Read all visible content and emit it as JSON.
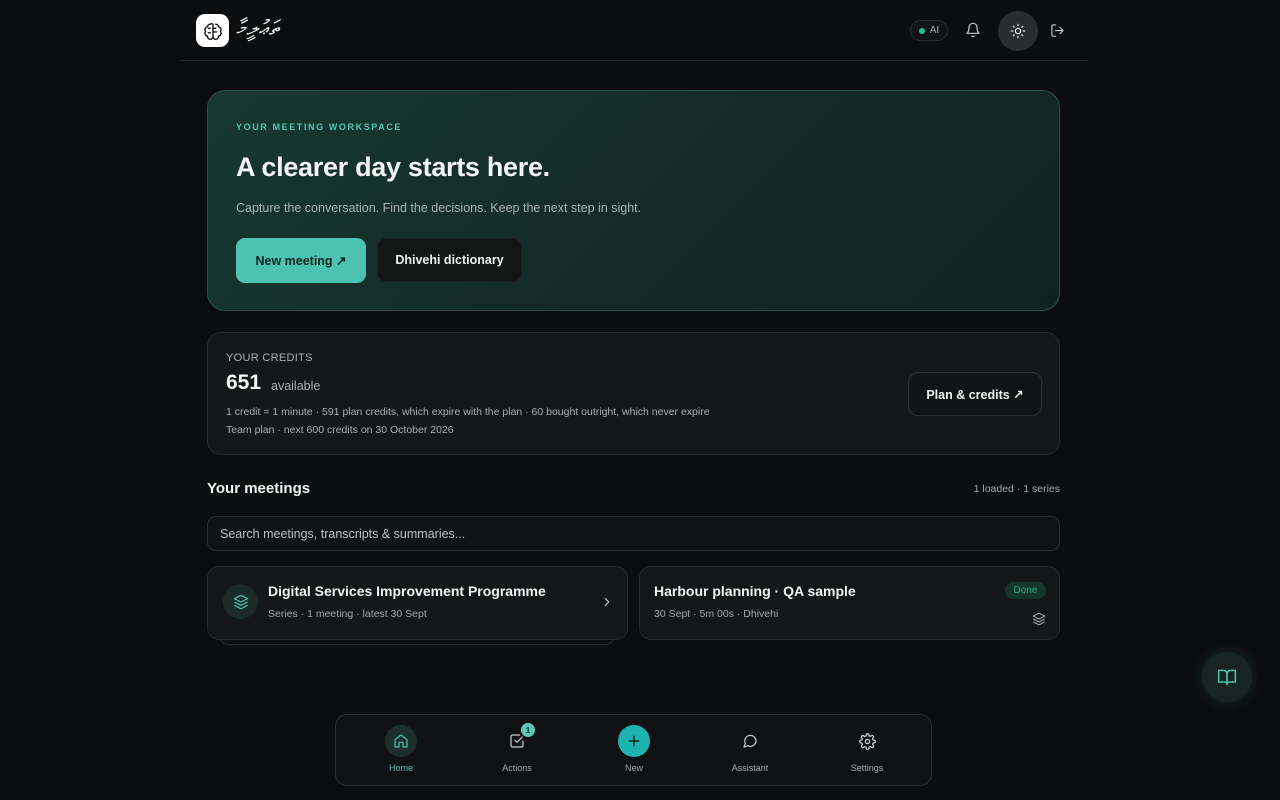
{
  "header": {
    "brand": "ތަޢުލީމާ",
    "ai_label": "AI",
    "colors": {
      "ai_status": "#22c08a"
    }
  },
  "hero": {
    "kicker": "YOUR MEETING WORKSPACE",
    "title": "A clearer day starts here.",
    "subtitle": "Capture the conversation. Find the decisions. Keep the next step in sight.",
    "primary_button": "New meeting ↗",
    "secondary_button": "Dhivehi dictionary",
    "colors": {
      "accent": "#4cc2b0"
    }
  },
  "credits": {
    "label": "YOUR CREDITS",
    "amount": "651",
    "available": "available",
    "detail": "1 credit = 1 minute · 591 plan credits, which expire with the plan · 60 bought outright, which never expire",
    "plan_line": "Team plan · next 600 credits on 30 October 2026",
    "button": "Plan & credits ↗"
  },
  "meetings": {
    "title": "Your meetings",
    "count": "1 loaded · 1 series",
    "search_placeholder": "Search meetings, transcripts & summaries...",
    "cards": [
      {
        "title": "Digital Services Improvement Programme",
        "meta": "Series · 1 meeting · latest 30 Sept",
        "icon": "layers-icon"
      },
      {
        "title": "Harbour planning · QA sample",
        "meta": "30 Sept · 5m 00s · Dhivehi",
        "status": "Done",
        "icon": "layers-icon"
      }
    ]
  },
  "nav": {
    "items": [
      {
        "label": "Home",
        "icon": "home-icon"
      },
      {
        "label": "Actions",
        "icon": "checkbox-icon",
        "badge": "1"
      },
      {
        "label": "New",
        "icon": "plus-icon"
      },
      {
        "label": "Assistant",
        "icon": "chat-icon"
      },
      {
        "label": "Settings",
        "icon": "gear-icon"
      }
    ]
  }
}
